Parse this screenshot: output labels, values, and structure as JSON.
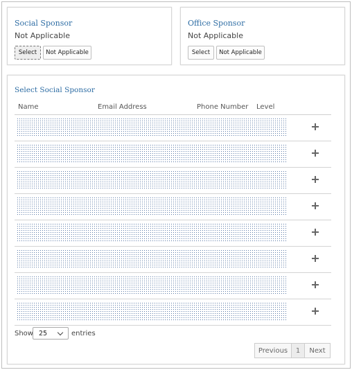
{
  "social_sponsor": {
    "title": "Social Sponsor",
    "value": "Not Applicable",
    "select_label": "Select",
    "not_applicable_label": "Not Applicable"
  },
  "office_sponsor": {
    "title": "Office Sponsor",
    "value": "Not Applicable",
    "select_label": "Select",
    "not_applicable_label": "Not Applicable"
  },
  "select_section": {
    "title": "Select Social Sponsor",
    "columns": [
      "Name",
      "Email Address",
      "Phone Number",
      "Level"
    ],
    "row_count": 8,
    "row_icon": "plus-icon"
  },
  "table_footer": {
    "show_label": "Show",
    "page_size": "25",
    "entries_label": "entries",
    "previous_label": "Previous",
    "current_page": "1",
    "next_label": "Next"
  },
  "colors": {
    "title_blue": "#2e6da4",
    "redaction_dots": "#5f7faa"
  }
}
